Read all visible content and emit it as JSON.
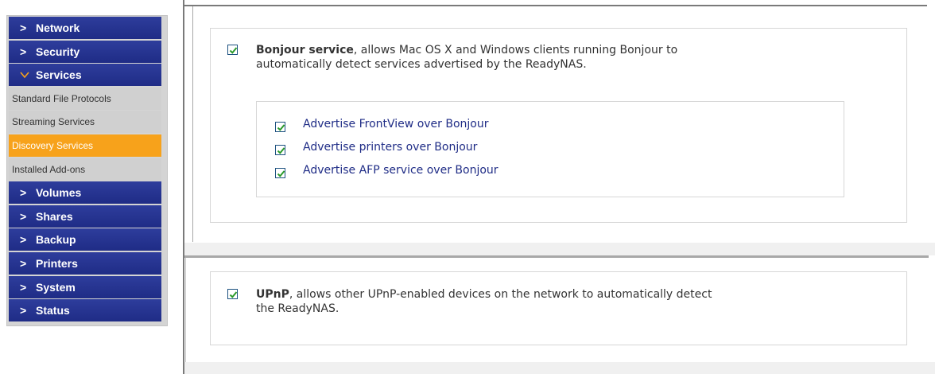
{
  "sidebar": {
    "items_top": [
      {
        "label": "Network",
        "icon": "chevron-right-icon"
      },
      {
        "label": "Security",
        "icon": "chevron-right-icon"
      },
      {
        "label": "Services",
        "icon": "chevron-down-icon",
        "expanded": true
      }
    ],
    "sub_items": [
      {
        "label": "Standard File Protocols",
        "active": false
      },
      {
        "label": "Streaming Services",
        "active": false
      },
      {
        "label": "Discovery Services",
        "active": true
      },
      {
        "label": "Installed Add-ons",
        "active": false
      }
    ],
    "items_bottom": [
      {
        "label": "Volumes"
      },
      {
        "label": "Shares"
      },
      {
        "label": "Backup"
      },
      {
        "label": "Printers"
      },
      {
        "label": "System"
      },
      {
        "label": "Status"
      }
    ],
    "chevron_right": ">",
    "chevron_down": "v"
  },
  "bonjour": {
    "checked": true,
    "title": "Bonjour service",
    "description_line1": ", allows Mac OS X and Windows clients running Bonjour to",
    "description_line2": "automatically detect services advertised by the ReadyNAS.",
    "options": [
      {
        "label": "Advertise FrontView over Bonjour",
        "checked": true
      },
      {
        "label": "Advertise printers over Bonjour",
        "checked": true
      },
      {
        "label": "Advertise AFP service over Bonjour",
        "checked": true
      }
    ]
  },
  "upnp": {
    "checked": true,
    "title": "UPnP",
    "description_line1": ", allows other UPnP-enabled devices on the network to automatically detect",
    "description_line2": "the ReadyNAS."
  },
  "colors": {
    "nav_bg": "#25338f",
    "active_sub_bg": "#f7a21b",
    "sub_bg": "#d0d0d0",
    "checkbox_border": "#1c5180",
    "check_green": "#2b9a2b"
  }
}
